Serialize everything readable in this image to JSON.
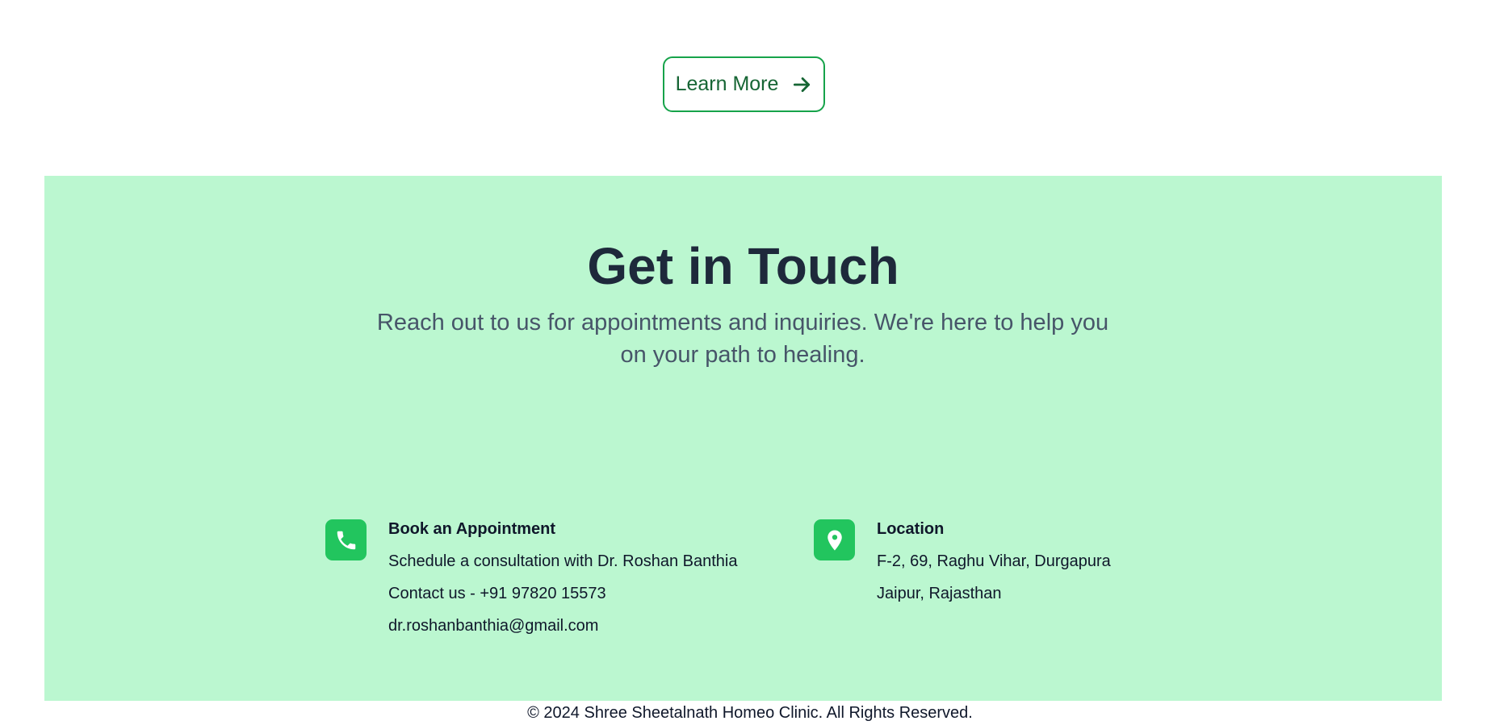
{
  "learn_more": {
    "label": "Learn More",
    "icon": "arrow-right-icon"
  },
  "contact": {
    "title": "Get in Touch",
    "subtitle": "Reach out to us for appointments and inquiries. We're here to help you on your path to healing.",
    "background": "#bbf7d0",
    "accent": "#22c55e",
    "appointment": {
      "icon": "phone-icon",
      "title": "Book an Appointment",
      "lines": [
        "Schedule a consultation with Dr. Roshan Banthia",
        "Contact us - +91 97820 15573",
        "dr.roshanbanthia@gmail.com"
      ]
    },
    "location": {
      "icon": "map-pin-icon",
      "title": "Location",
      "lines": [
        "F-2, 69, Raghu Vihar, Durgapura",
        "Jaipur, Rajasthan"
      ]
    }
  },
  "footer": {
    "text": "© 2024 Shree Sheetalnath Homeo Clinic. All Rights Reserved."
  }
}
